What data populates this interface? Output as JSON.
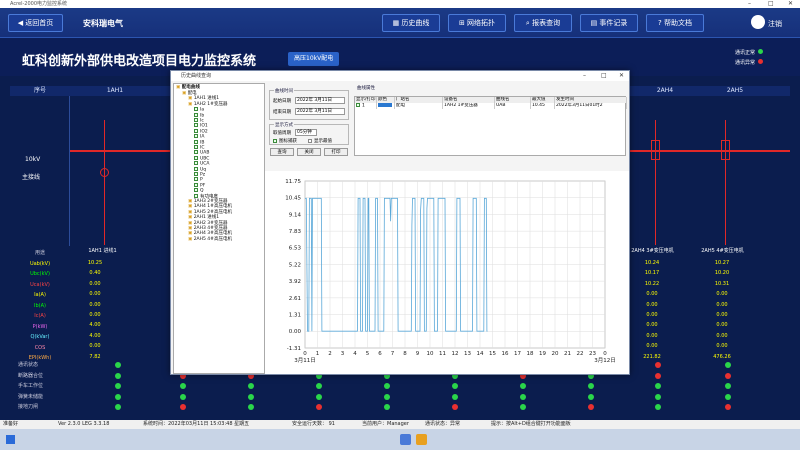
{
  "window": {
    "title": "Acrel-2000电力监控系统"
  },
  "topbar": {
    "home_label": "返回首页",
    "company": "安科瑞电气",
    "history_label": "历史曲线",
    "topology_label": "网络拓扑",
    "report_label": "报表查询",
    "events_label": "事件记录",
    "help_label": "帮助文档",
    "logout_label": "注销"
  },
  "main": {
    "title": "虹科创新外部供电改造项目电力监控系统",
    "tab_active": "高压10kV配电",
    "legend": [
      {
        "label": "通讯正常",
        "color": "#2ad64a"
      },
      {
        "label": "通讯异常",
        "color": "#e83030"
      }
    ]
  },
  "columns": [
    "序号",
    "1AH1",
    "2AH4",
    "2AH5"
  ],
  "busbar": {
    "voltage": "10kV",
    "name": "主接线"
  },
  "data_labels": [
    "用途",
    "Uab(kV)",
    "Ubc(kV)",
    "Uca(kV)",
    "Ia(A)",
    "Ib(A)",
    "Ic(A)",
    "P(kW)",
    "Q(kVar)",
    "COS",
    "EPI(kWh)"
  ],
  "col_names": {
    "c1": "1AH1 进线1",
    "c2": "2AH4 3#变压电机",
    "c3": "2AH5 4#变压电机"
  },
  "values": {
    "c1": [
      "10.25",
      "0.40",
      "0.00",
      "0.00",
      "0.00",
      "0.00",
      "4.00",
      "4.00",
      "0.00",
      "7.82"
    ],
    "c2": [
      "10.24",
      "10.17",
      "10.22",
      "0.00",
      "0.00",
      "0.00",
      "0.00",
      "0.00",
      "0.00",
      "221.82"
    ],
    "c3": [
      "10.27",
      "10.20",
      "10.31",
      "0.00",
      "0.00",
      "0.00",
      "0.00",
      "0.00",
      "0.00",
      "476.26"
    ]
  },
  "status_labels": [
    "通讯状态",
    "断路器合位",
    "手车工作位",
    "弹簧未储能",
    "接地刀闸"
  ],
  "statusbar": {
    "ready": "准备好",
    "version": "Ver 2.3.0 LEG 3.3.18",
    "time_label": "系统时间：2022年03月11日  15:03:48  星期五",
    "safe_days": "安全运行天数：  91",
    "user": "当前用户：Manager",
    "comm": "通讯状态：异常",
    "tip": "提示：按Alt+D组合键打开功能面板"
  },
  "dialog": {
    "title": "历史曲线查询",
    "tree_root": "配电曲线",
    "tree_items": [
      {
        "t": "配电",
        "l": 1
      },
      {
        "t": "1AH1  进线1",
        "l": 2
      },
      {
        "t": "1AH2  1#变压器",
        "l": 2
      },
      {
        "t": "Ia",
        "l": 3
      },
      {
        "t": "Ib",
        "l": 3
      },
      {
        "t": "Ic",
        "l": 3
      },
      {
        "t": "IO1",
        "l": 3
      },
      {
        "t": "IO2",
        "l": 3
      },
      {
        "t": "IA",
        "l": 3
      },
      {
        "t": "IB",
        "l": 3
      },
      {
        "t": "IC",
        "l": 3
      },
      {
        "t": "UAB",
        "l": 3
      },
      {
        "t": "UBC",
        "l": 3
      },
      {
        "t": "UCA",
        "l": 3
      },
      {
        "t": "Uq",
        "l": 3
      },
      {
        "t": "Pz",
        "l": 3
      },
      {
        "t": "P",
        "l": 3
      },
      {
        "t": "PF",
        "l": 3
      },
      {
        "t": "Q",
        "l": 3
      },
      {
        "t": "有功电度",
        "l": 3
      },
      {
        "t": "1AH3  2#变压器",
        "l": 2
      },
      {
        "t": "1AH4  1#高压电机",
        "l": 2
      },
      {
        "t": "1AH5  2#高压电机",
        "l": 2
      },
      {
        "t": "2AH1  进线1",
        "l": 2
      },
      {
        "t": "2AH2  3#变压器",
        "l": 2
      },
      {
        "t": "2AH3  4#变压器",
        "l": 2
      },
      {
        "t": "2AH4  3#高压电机",
        "l": 2
      },
      {
        "t": "2AH5  4#高压电机",
        "l": 2
      }
    ],
    "time_group": "曲线时间",
    "start_label": "起始日期",
    "start_value": "2022年 3月11日",
    "end_label": "结束日期",
    "end_value": "2022年 3月11日",
    "mode_group": "显示方式",
    "interval_label": "取值周期",
    "interval_value": "05分钟",
    "cursor_label": "图标捕获",
    "max_label": "显示最值",
    "query_btn": "查询",
    "close_btn": "关闭",
    "print_btn": "打印",
    "prop_group": "曲线属性",
    "prop_headers": [
      "显示/打印",
      "颜色",
      "厂站名",
      "设备名",
      "曲线名",
      "最大值",
      "发生时间"
    ],
    "prop_row": [
      "1",
      "",
      "配电",
      "1AH2  1#变压器",
      "UAB",
      "10.45",
      "2022年3月11日01时2"
    ]
  },
  "chart_data": {
    "type": "line",
    "title": "",
    "xlabel": "",
    "ylabel": "",
    "x_ticks": [
      "0",
      "1",
      "2",
      "3",
      "4",
      "5",
      "6",
      "7",
      "8",
      "9",
      "10",
      "11",
      "12",
      "13",
      "14",
      "15",
      "16",
      "17",
      "18",
      "19",
      "20",
      "21",
      "22",
      "23",
      "0"
    ],
    "x_date_labels": [
      "3月11日",
      "3月12日"
    ],
    "y_ticks": [
      "11.75",
      "10.45",
      "9.14",
      "7.83",
      "6.53",
      "5.22",
      "3.92",
      "2.61",
      "1.31",
      "0.00",
      "-1.31"
    ],
    "ylim": [
      -1.31,
      11.75
    ],
    "xlim": [
      0,
      24
    ],
    "grid": true,
    "series": [
      {
        "color": "#5aa8d8",
        "points": [
          [
            0,
            10.4
          ],
          [
            0.1,
            10.4
          ],
          [
            0.2,
            0
          ],
          [
            0.3,
            0
          ],
          [
            0.35,
            10.4
          ],
          [
            0.4,
            10.4
          ],
          [
            0.5,
            10.4
          ],
          [
            0.55,
            0
          ],
          [
            0.6,
            10.4
          ],
          [
            1.3,
            10.4
          ],
          [
            1.35,
            0
          ],
          [
            2.0,
            0
          ],
          [
            4.2,
            0
          ],
          [
            4.25,
            10.4
          ],
          [
            4.4,
            10.4
          ],
          [
            4.45,
            0
          ],
          [
            4.6,
            0
          ],
          [
            4.65,
            10.4
          ],
          [
            4.8,
            10.4
          ],
          [
            4.85,
            0
          ],
          [
            5.0,
            0
          ],
          [
            5.05,
            10.4
          ],
          [
            5.1,
            10.4
          ],
          [
            5.15,
            0
          ],
          [
            5.6,
            0
          ],
          [
            5.65,
            10.4
          ],
          [
            5.8,
            10.4
          ],
          [
            5.85,
            0
          ],
          [
            6.3,
            0
          ],
          [
            6.35,
            10.4
          ],
          [
            6.8,
            10.4
          ],
          [
            6.85,
            8.6
          ],
          [
            6.9,
            10.4
          ],
          [
            7.4,
            10.4
          ],
          [
            7.45,
            0
          ],
          [
            8.5,
            0
          ],
          [
            8.55,
            8.3
          ],
          [
            8.6,
            10.4
          ],
          [
            8.8,
            10.4
          ],
          [
            8.85,
            0
          ],
          [
            9.2,
            0
          ],
          [
            9.25,
            9.5
          ],
          [
            9.3,
            10.4
          ],
          [
            9.5,
            10.4
          ],
          [
            9.55,
            0
          ],
          [
            9.7,
            0
          ],
          [
            9.75,
            9.6
          ],
          [
            9.8,
            10.4
          ],
          [
            10.3,
            10.4
          ],
          [
            10.35,
            0
          ],
          [
            10.6,
            0
          ],
          [
            10.65,
            10.4
          ],
          [
            11.2,
            10.4
          ],
          [
            11.25,
            0
          ],
          [
            12.1,
            0
          ],
          [
            12.15,
            10.4
          ],
          [
            12.4,
            10.4
          ],
          [
            12.45,
            0
          ],
          [
            13.4,
            0
          ],
          [
            13.45,
            10.4
          ],
          [
            13.7,
            10.4
          ],
          [
            13.75,
            0
          ],
          [
            14.3,
            0
          ],
          [
            14.35,
            10.4
          ],
          [
            14.5,
            10.4
          ],
          [
            14.55,
            0
          ],
          [
            14.6,
            0
          ]
        ]
      }
    ]
  }
}
